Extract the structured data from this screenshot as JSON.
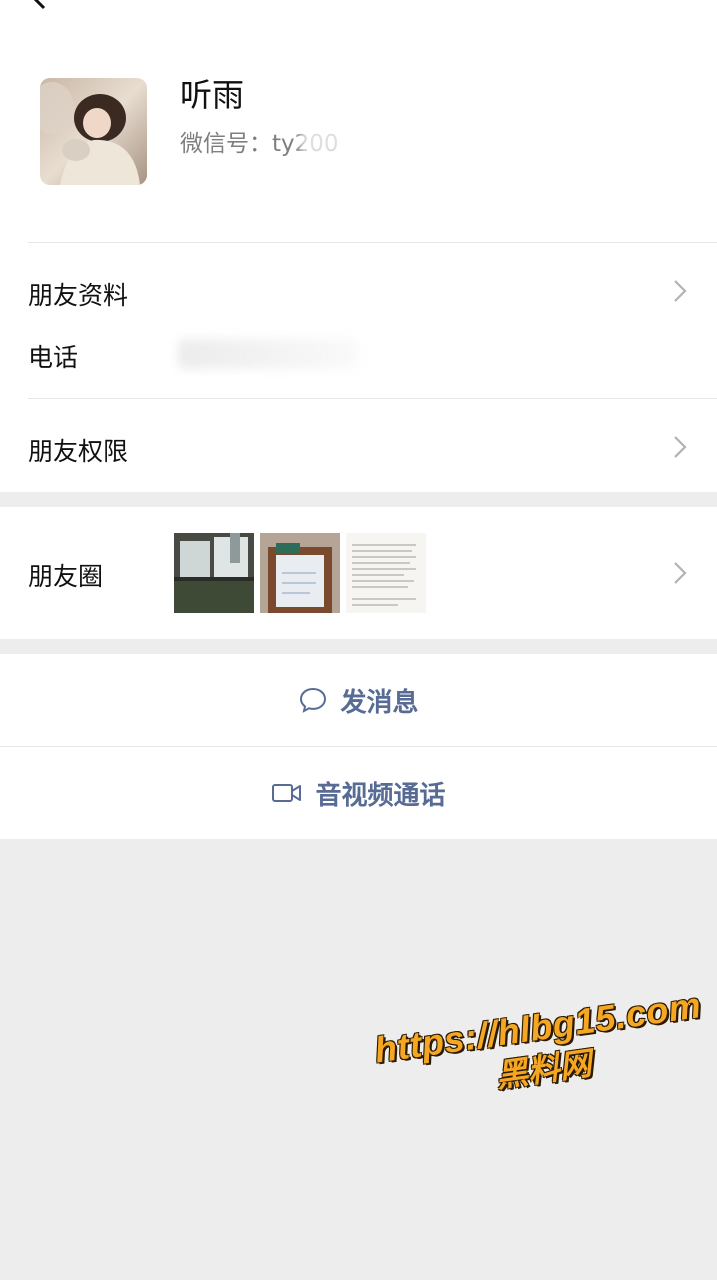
{
  "profile": {
    "name": "听雨",
    "wechat_id_label": "微信号：ty200"
  },
  "rows": {
    "friend_profile": "朋友资料",
    "phone": "电话",
    "friend_permissions": "朋友权限",
    "moments": "朋友圈"
  },
  "actions": {
    "send_message": "发消息",
    "av_call": "音视频通话"
  },
  "watermark": {
    "url": "https://hlbg15.com",
    "name": "黑料网"
  },
  "colors": {
    "link": "#576b95",
    "background": "#ededed",
    "watermark": "#f5a623"
  },
  "icons": [
    "back-arrow-icon",
    "chevron-right-icon",
    "chat-bubble-icon",
    "video-camera-icon"
  ]
}
